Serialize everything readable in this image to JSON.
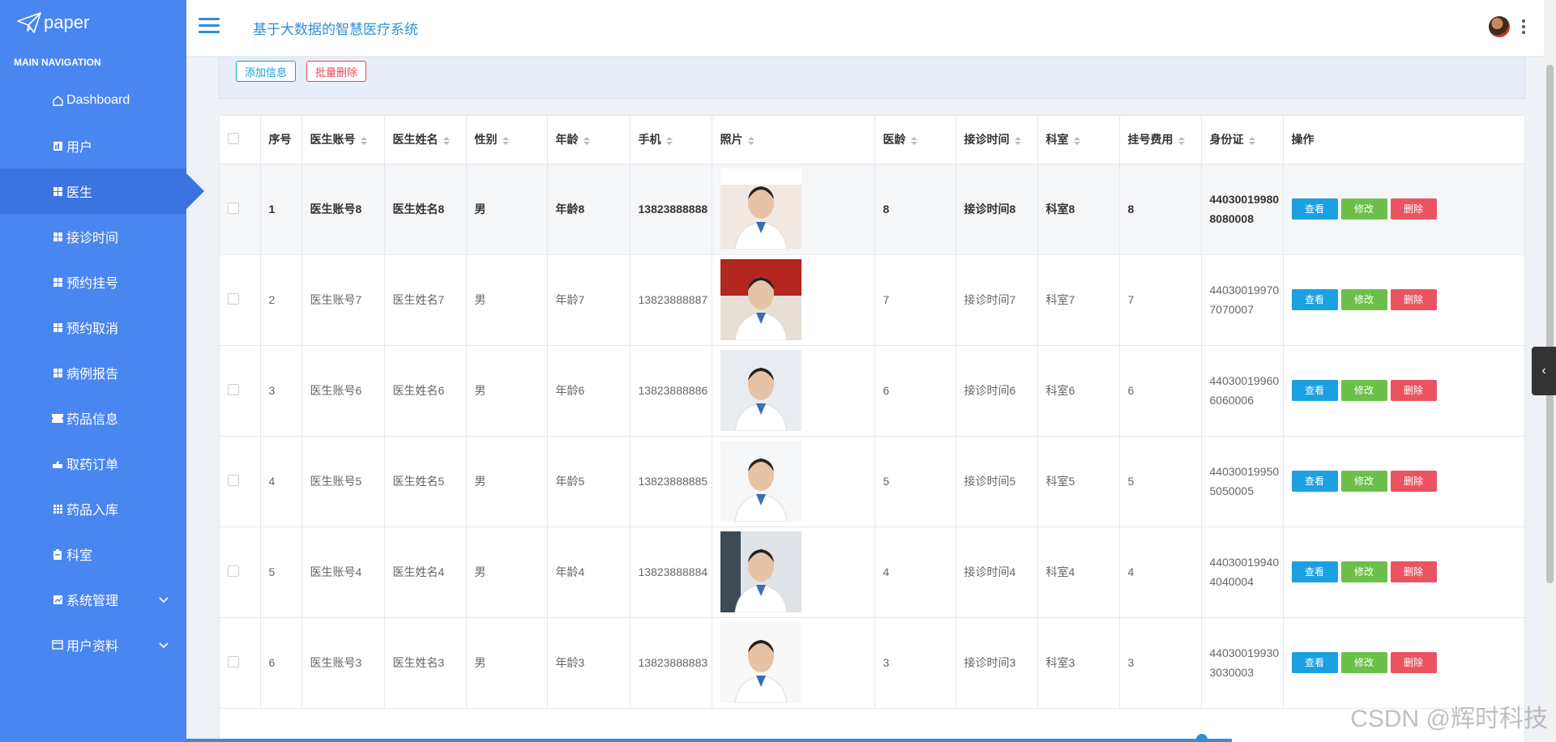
{
  "app": {
    "logo_text": "paper",
    "nav_header": "MAIN NAVIGATION",
    "system_title": "基于大数据的智慧医疗系统"
  },
  "sidebar": {
    "items": [
      {
        "label": "Dashboard",
        "icon": "home-icon"
      },
      {
        "label": "用户",
        "icon": "chart-icon"
      },
      {
        "label": "医生",
        "icon": "grid-icon",
        "active": true
      },
      {
        "label": "接诊时间",
        "icon": "grid-icon"
      },
      {
        "label": "预约挂号",
        "icon": "grid-icon"
      },
      {
        "label": "预约取消",
        "icon": "grid-icon"
      },
      {
        "label": "病例报告",
        "icon": "grid-icon"
      },
      {
        "label": "药品信息",
        "icon": "ticket-icon"
      },
      {
        "label": "取药订单",
        "icon": "hand-icon"
      },
      {
        "label": "药品入库",
        "icon": "table-icon"
      },
      {
        "label": "科室",
        "icon": "clipboard-icon"
      },
      {
        "label": "系统管理",
        "icon": "chart-icon",
        "expandable": true
      },
      {
        "label": "用户资料",
        "icon": "card-icon",
        "expandable": true
      }
    ]
  },
  "actions": {
    "add_label": "添加信息",
    "batch_delete_label": "批量删除"
  },
  "table": {
    "columns": [
      "序号",
      "医生账号",
      "医生姓名",
      "性别",
      "年龄",
      "手机",
      "照片",
      "医龄",
      "接诊时间",
      "科室",
      "挂号费用",
      "身份证",
      "操作"
    ],
    "rows": [
      {
        "no": "1",
        "account": "医生账号8",
        "name": "医生姓名8",
        "gender": "男",
        "age": "年龄8",
        "phone": "13823888888",
        "years": "8",
        "time": "接诊时间8",
        "dept": "科室8",
        "fee": "8",
        "id": "440300199808080008"
      },
      {
        "no": "2",
        "account": "医生账号7",
        "name": "医生姓名7",
        "gender": "男",
        "age": "年龄7",
        "phone": "13823888887",
        "years": "7",
        "time": "接诊时间7",
        "dept": "科室7",
        "fee": "7",
        "id": "440300199707070007"
      },
      {
        "no": "3",
        "account": "医生账号6",
        "name": "医生姓名6",
        "gender": "男",
        "age": "年龄6",
        "phone": "13823888886",
        "years": "6",
        "time": "接诊时间6",
        "dept": "科室6",
        "fee": "6",
        "id": "440300199606060006"
      },
      {
        "no": "4",
        "account": "医生账号5",
        "name": "医生姓名5",
        "gender": "男",
        "age": "年龄5",
        "phone": "13823888885",
        "years": "5",
        "time": "接诊时间5",
        "dept": "科室5",
        "fee": "5",
        "id": "440300199505050005"
      },
      {
        "no": "5",
        "account": "医生账号4",
        "name": "医生姓名4",
        "gender": "男",
        "age": "年龄4",
        "phone": "13823888884",
        "years": "4",
        "time": "接诊时间4",
        "dept": "科室4",
        "fee": "4",
        "id": "440300199404040004"
      },
      {
        "no": "6",
        "account": "医生账号3",
        "name": "医生姓名3",
        "gender": "男",
        "age": "年龄3",
        "phone": "13823888883",
        "years": "3",
        "time": "接诊时间3",
        "dept": "科室3",
        "fee": "3",
        "id": "440300199303030003"
      }
    ],
    "op_labels": {
      "view": "查看",
      "edit": "修改",
      "delete": "删除"
    }
  },
  "watermark": "CSDN @辉时科技",
  "colors": {
    "sidebar": "#4a86f0",
    "sidebar_active": "#3b74e0",
    "accent": "#2f8fd8",
    "view_button": "#1ba0e2",
    "edit_button": "#6cc04a",
    "delete_button": "#ea5460"
  }
}
